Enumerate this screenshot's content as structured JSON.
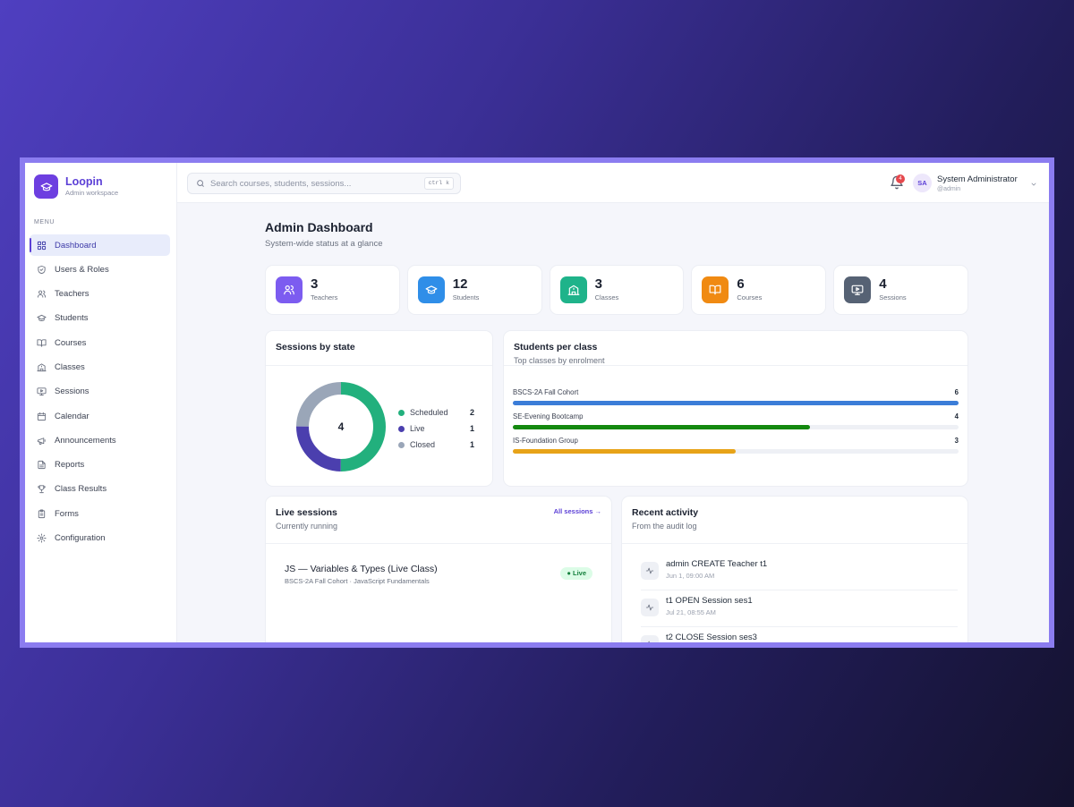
{
  "brand": {
    "name": "Loopin",
    "subtitle": "Admin workspace"
  },
  "sidebar": {
    "menu_label": "MENU",
    "items": [
      {
        "label": "Dashboard",
        "icon": "grid-icon",
        "active": true
      },
      {
        "label": "Users & Roles",
        "icon": "shield-icon"
      },
      {
        "label": "Teachers",
        "icon": "users-icon"
      },
      {
        "label": "Students",
        "icon": "graduation-cap-icon"
      },
      {
        "label": "Courses",
        "icon": "book-icon"
      },
      {
        "label": "Classes",
        "icon": "building-icon"
      },
      {
        "label": "Sessions",
        "icon": "monitor-play-icon"
      },
      {
        "label": "Calendar",
        "icon": "calendar-icon"
      },
      {
        "label": "Announcements",
        "icon": "megaphone-icon"
      },
      {
        "label": "Reports",
        "icon": "file-icon"
      },
      {
        "label": "Class Results",
        "icon": "trophy-icon"
      },
      {
        "label": "Forms",
        "icon": "clipboard-icon"
      },
      {
        "label": "Configuration",
        "icon": "gear-icon"
      }
    ]
  },
  "topbar": {
    "search_placeholder": "Search courses, students, sessions...",
    "search_shortcut": "ctrl k",
    "notification_count": "4",
    "user": {
      "initials": "SA",
      "name": "System Administrator",
      "handle": "@admin"
    }
  },
  "page": {
    "title": "Admin Dashboard",
    "subtitle": "System-wide status at a glance"
  },
  "stats": [
    {
      "value": "3",
      "label": "Teachers",
      "color": "#7c5cf0",
      "icon": "users-icon"
    },
    {
      "value": "12",
      "label": "Students",
      "color": "#2f8ee8",
      "icon": "graduation-cap-icon"
    },
    {
      "value": "3",
      "label": "Classes",
      "color": "#1fb38a",
      "icon": "building-icon"
    },
    {
      "value": "6",
      "label": "Courses",
      "color": "#f08a12",
      "icon": "book-icon"
    },
    {
      "value": "4",
      "label": "Sessions",
      "color": "#566274",
      "icon": "monitor-play-icon"
    }
  ],
  "sessions_by_state": {
    "title": "Sessions by state",
    "total": "4",
    "states": [
      {
        "name": "Scheduled",
        "count": 2,
        "color": "#22b07d"
      },
      {
        "name": "Live",
        "count": 1,
        "color": "#4b3fae"
      },
      {
        "name": "Closed",
        "count": 1,
        "color": "#9aa6b8"
      }
    ]
  },
  "students_per_class": {
    "title": "Students per class",
    "subtitle": "Top classes by enrolment",
    "max": 6,
    "classes": [
      {
        "name": "BSCS-2A Fall Cohort",
        "value": 6,
        "color": "#3b7dd8"
      },
      {
        "name": "SE-Evening Bootcamp",
        "value": 4,
        "color": "#14890f"
      },
      {
        "name": "IS-Foundation Group",
        "value": 3,
        "color": "#e7a318"
      }
    ]
  },
  "live_sessions": {
    "title": "Live sessions",
    "subtitle": "Currently running",
    "link": "All sessions →",
    "items": [
      {
        "title": "JS — Variables & Types (Live Class)",
        "meta": "BSCS-2A Fall Cohort · JavaScript Fundamentals",
        "status": "● Live"
      }
    ]
  },
  "recent_activity": {
    "title": "Recent activity",
    "subtitle": "From the audit log",
    "items": [
      {
        "text": "admin CREATE Teacher t1",
        "time": "Jun 1, 09:00 AM"
      },
      {
        "text": "t1 OPEN Session ses1",
        "time": "Jul 21, 08:55 AM"
      },
      {
        "text": "t2 CLOSE Session ses3",
        "time": ""
      }
    ]
  }
}
